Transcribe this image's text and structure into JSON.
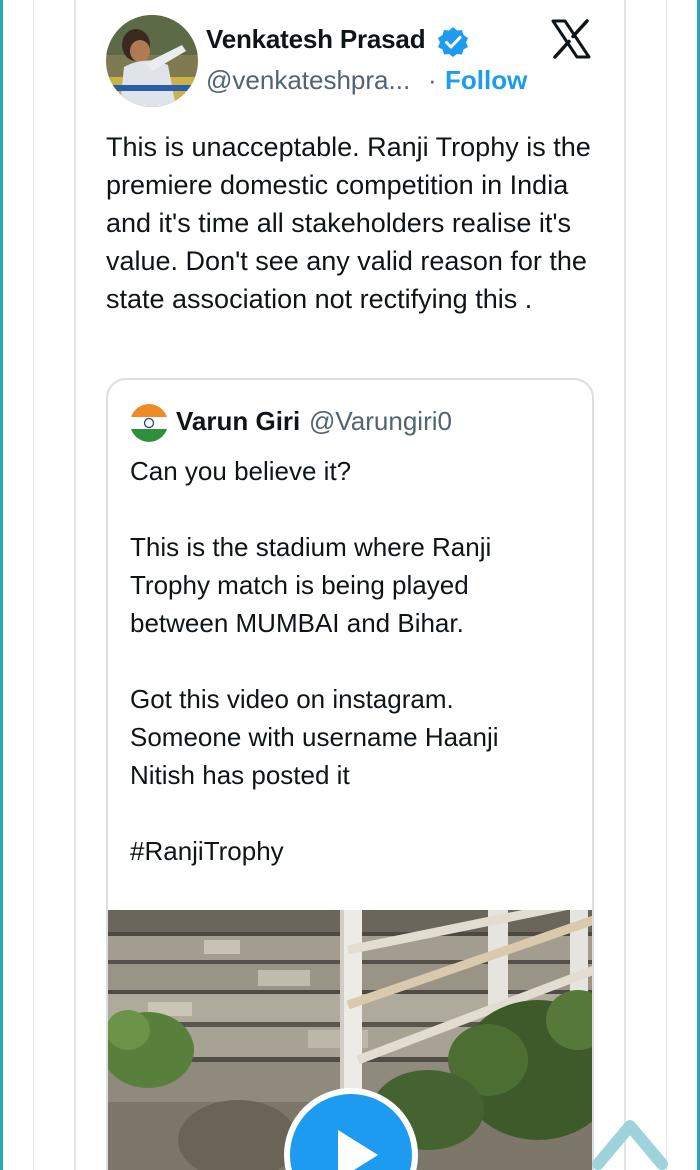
{
  "tweet": {
    "author_name": "Venkatesh Prasad",
    "author_handle": "@venkateshpra...",
    "separator": "·",
    "follow_label": "Follow",
    "verified_icon": "verified-badge-icon",
    "platform_icon": "x-logo-icon",
    "text": "This is unacceptable. Ranji Trophy is the premiere domestic competition in India and it's time all stakeholders realise it's value. Don't see any valid reason for the state association not rectifying this ."
  },
  "quoted_tweet": {
    "author_name": "Varun Giri",
    "author_handle": "@Varungiri0",
    "text": "Can you believe it?\n\nThis is the stadium where Ranji Trophy match is being played between MUMBAI and Bihar.\n\nGot this video on instagram. Someone with username Haanji Nitish has posted it\n\n#RanjiTrophy",
    "media_icon": "play-icon"
  },
  "floating": {
    "scroll_icon": "chevron-up-icon"
  },
  "colors": {
    "accent": "#1d9bf0",
    "text": "#0f1419",
    "muted": "#536471",
    "edge": "#2aa8b8"
  }
}
